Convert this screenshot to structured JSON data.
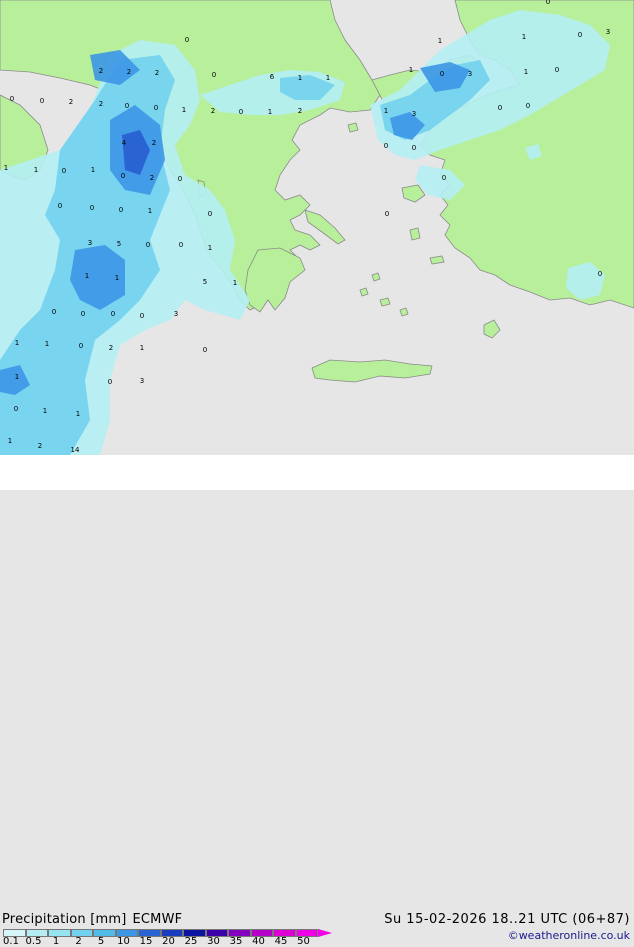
{
  "map": {
    "title": "Precipitation [mm]",
    "model": "ECMWF",
    "valid_time": "Su 15-02-2026 18..21 UTC (06+87)",
    "credit": "©weatheronline.co.uk",
    "colors": {
      "sea": "#e6e6e6",
      "land": "#b8ef9a",
      "coast": "#8a8a8a",
      "precip_light": "#b4eef4",
      "precip_mid": "#72d2ee",
      "precip_heavy": "#3c96e6",
      "precip_strong": "#2a64d2"
    },
    "scale": {
      "labels": [
        "0.1",
        "0.5",
        "1",
        "2",
        "5",
        "10",
        "15",
        "20",
        "25",
        "30",
        "35",
        "40",
        "45",
        "50"
      ],
      "colors": [
        "#d6f6fa",
        "#b4eef4",
        "#96e4f2",
        "#72d2ee",
        "#52bce8",
        "#3c96e6",
        "#2a64d2",
        "#1a3cbe",
        "#0a14a0",
        "#3c00aa",
        "#8200be",
        "#b400c8",
        "#dc00d2",
        "#f000e6"
      ]
    },
    "values": [
      "0",
      "2",
      "2",
      "2",
      "0",
      "0",
      "0",
      "2",
      "2",
      "0",
      "0",
      "1",
      "2",
      "0",
      "1",
      "4",
      "2",
      "1",
      "1",
      "0",
      "1",
      "0",
      "2",
      "0",
      "0",
      "0",
      "0",
      "1",
      "0",
      "0",
      "3",
      "5",
      "0",
      "1",
      "1",
      "1",
      "5",
      "1",
      "0",
      "0",
      "0",
      "0",
      "3",
      "1",
      "1",
      "0",
      "2",
      "1",
      "0",
      "1",
      "0",
      "3",
      "0",
      "1",
      "1",
      "1",
      "2",
      "14",
      "6",
      "1",
      "1",
      "2",
      "1",
      "1",
      "0",
      "3",
      "0",
      "1",
      "0",
      "3",
      "1",
      "0",
      "1",
      "3",
      "0",
      "0",
      "0",
      "0",
      "0",
      "0",
      "0"
    ]
  }
}
